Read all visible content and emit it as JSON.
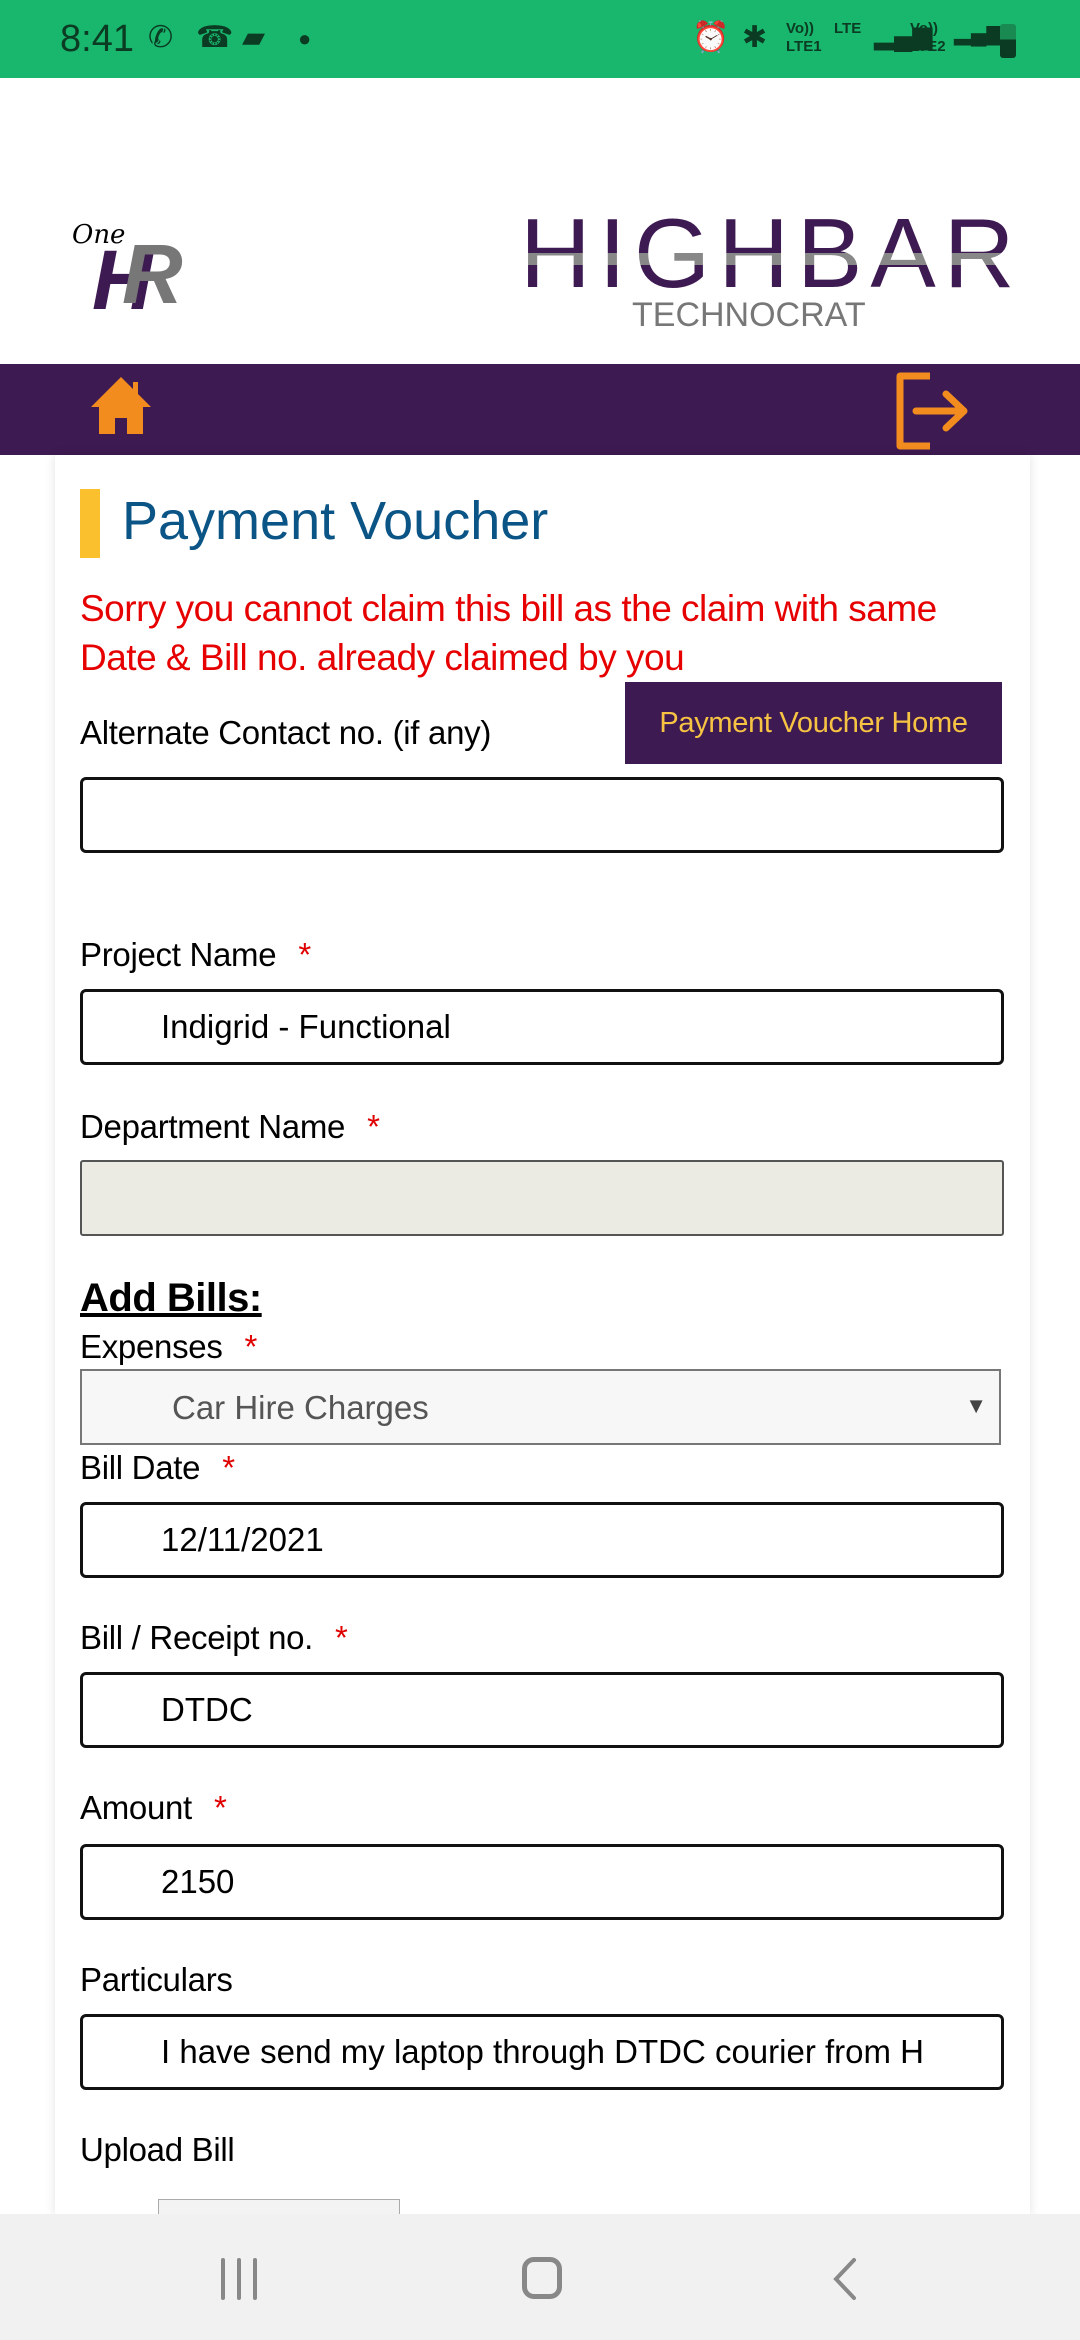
{
  "status_bar": {
    "time": "8:41",
    "left_icons": [
      "wifi-call-icon",
      "missed-call-icon",
      "message-icon",
      "dot-icon"
    ],
    "right_icons": [
      "alarm-icon",
      "bluetooth-icon",
      "volte-lte1-icon",
      "signal-icon",
      "volte-lte2-icon",
      "signal-icon",
      "battery-icon"
    ],
    "lte1": "LTE1",
    "lte2": "LTE2",
    "lte": "LTE",
    "volte": "Vo))"
  },
  "header": {
    "logo_left": "One HR",
    "logo_right": "HIGHBAR",
    "logo_right_sub": "TECHNOCRAT"
  },
  "nav": {
    "home_icon": "home-icon",
    "logout_icon": "logout-icon",
    "accent": "#f28c1e",
    "bar_color": "#3e1a52"
  },
  "page": {
    "title": "Payment Voucher",
    "error": "Sorry you cannot claim this bill as the claim with same Date & Bill no. already claimed by you",
    "home_button": "Payment Voucher Home"
  },
  "form": {
    "alt_contact_label": "Alternate Contact no. (if any)",
    "alt_contact_value": "",
    "project_label": "Project Name",
    "project_value": "Indigrid - Functional",
    "department_label": "Department Name",
    "department_value": "",
    "add_bills": "Add Bills:",
    "expenses_label": "Expenses",
    "expenses_value": "Car Hire Charges",
    "bill_date_label": "Bill Date",
    "bill_date_value": "12/11/2021",
    "receipt_label": "Bill / Receipt no.",
    "receipt_value": "DTDC",
    "amount_label": "Amount",
    "amount_value": "2150",
    "particulars_label": "Particulars",
    "particulars_value": "I have send my laptop through DTDC courier  from H",
    "upload_label": "Upload Bill",
    "required": "*"
  },
  "system_nav": {
    "recents": "recents-icon",
    "home": "home-circle-icon",
    "back": "back-icon"
  }
}
